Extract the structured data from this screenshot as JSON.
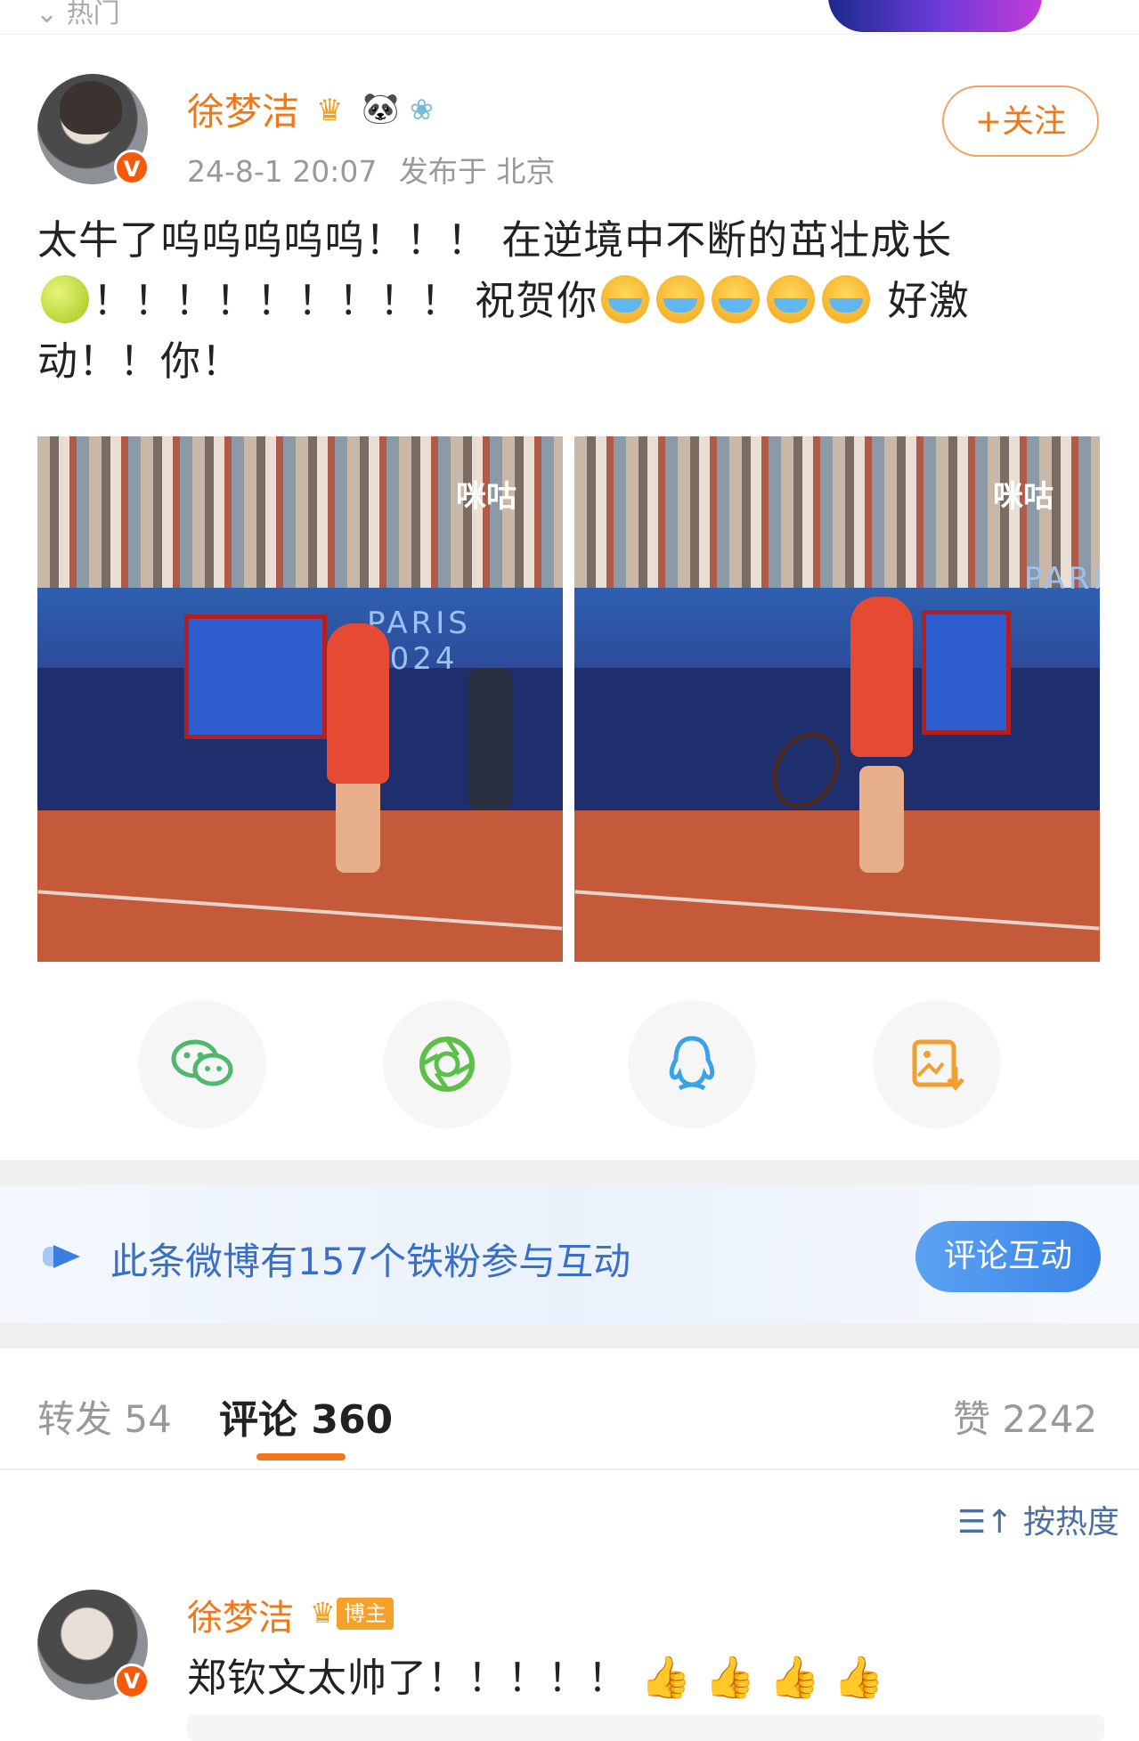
{
  "top": {
    "back_label": "热门"
  },
  "post": {
    "author": "徐梦洁",
    "badge_crown_icon": "crown-icon",
    "badge_panda": "🐼",
    "badge_fan": "❀",
    "time": "24-8-1 20:07",
    "location": "发布于 北京",
    "follow_label": "+关注",
    "text_line1": "太牛了呜呜呜呜呜！！！ 在逆境中不断的茁壮成长",
    "text_line2_a": "！！！！！！！！！ 祝贺你",
    "text_line2_b": " 好激",
    "text_line3": "动！！你！",
    "images": [
      {
        "watermark": "咪咕",
        "banner_text": "PARIS 2024"
      },
      {
        "watermark": "咪咕",
        "banner_text": "PARIS"
      }
    ]
  },
  "share": [
    {
      "name": "wechat",
      "icon": "wechat-icon",
      "color": "#4fb86e"
    },
    {
      "name": "moments",
      "icon": "moments-icon",
      "color": "#5bbf4a"
    },
    {
      "name": "qq",
      "icon": "qq-icon",
      "color": "#3aa2e8"
    },
    {
      "name": "save-image",
      "icon": "save-image-icon",
      "color": "#f0a030"
    }
  ],
  "fanbar": {
    "text": "此条微博有157个铁粉参与互动",
    "button_label": "评论互动"
  },
  "tabs": {
    "repost_label": "转发",
    "repost_count": "54",
    "comment_label": "评论",
    "comment_count": "360",
    "like_label": "赞",
    "like_count": "2242"
  },
  "sort": {
    "label": "按热度"
  },
  "comment": {
    "author": "徐梦洁",
    "tag": "博主",
    "text": "郑钦文太帅了！！！！！"
  },
  "colors": {
    "accent": "#f07818",
    "link_blue": "#3a6fc8"
  }
}
